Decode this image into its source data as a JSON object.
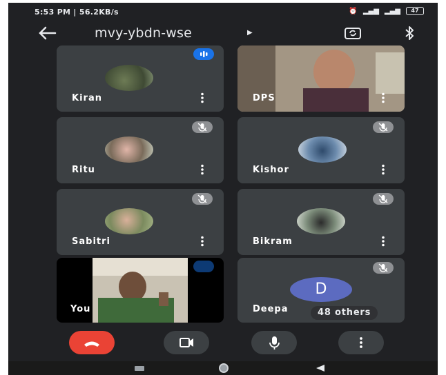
{
  "status_bar": {
    "time_speed": "5:53 PM | 56.2KB/s",
    "battery": "47"
  },
  "meeting": {
    "title": "mvy-ybdn-wse"
  },
  "participants": [
    {
      "name": "Kiran"
    },
    {
      "name": "DPS"
    },
    {
      "name": "Ritu"
    },
    {
      "name": "Kishor"
    },
    {
      "name": "Sabitri"
    },
    {
      "name": "Bikram"
    },
    {
      "name": "You"
    },
    {
      "name": "Deepa",
      "initial": "D"
    }
  ],
  "others_label": "48 others",
  "colors": {
    "background": "#202124",
    "tile": "#3c4043",
    "end_call": "#ea4335",
    "speaking": "#1a73e8",
    "avatar_d": "#5c6bc0"
  }
}
